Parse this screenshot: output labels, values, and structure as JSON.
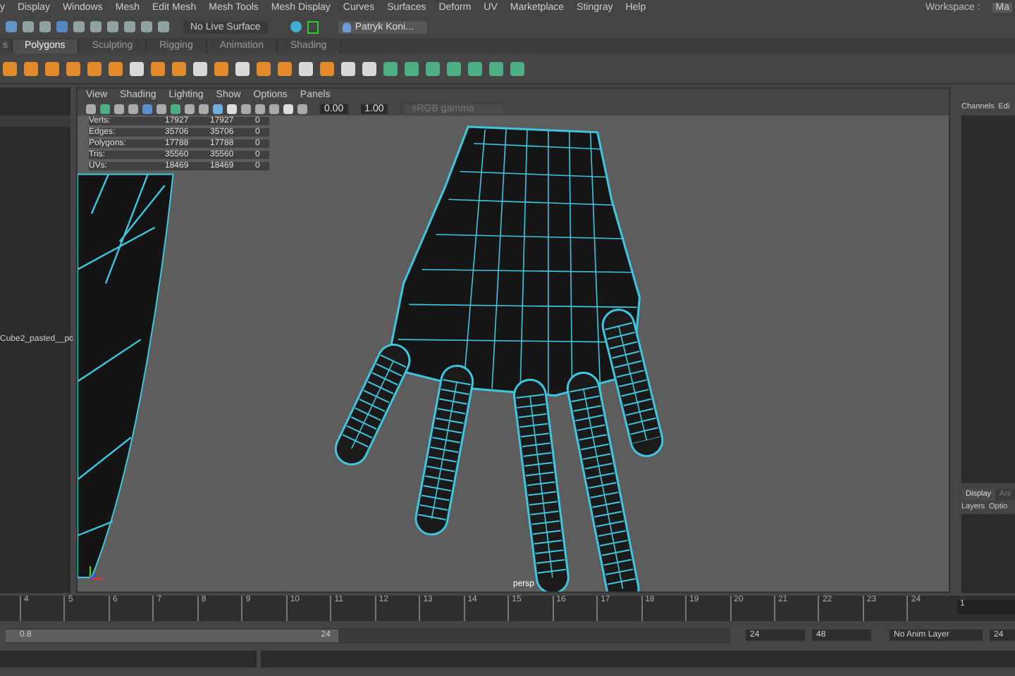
{
  "menu_bar": {
    "items": [
      "y",
      "Display",
      "Windows",
      "Mesh",
      "Edit Mesh",
      "Mesh Tools",
      "Mesh Display",
      "Curves",
      "Surfaces",
      "Deform",
      "UV",
      "Marketplace",
      "Stingray",
      "Help"
    ],
    "workspace_label": "Workspace :",
    "workspace_value": "Ma"
  },
  "status_line": {
    "live_surface": "No Live Surface",
    "user": "Patryk Koni..."
  },
  "shelf_tabs": [
    {
      "label": "s",
      "selected": false
    },
    {
      "label": "Polygons",
      "selected": true
    },
    {
      "label": "Sculpting",
      "selected": false
    },
    {
      "label": "Rigging",
      "selected": false
    },
    {
      "label": "Animation",
      "selected": false
    },
    {
      "label": "Shading",
      "selected": false
    }
  ],
  "outliner": {
    "item": "Cube2_pasted__pc"
  },
  "viewport": {
    "menu": [
      "View",
      "Shading",
      "Lighting",
      "Show",
      "Options",
      "Panels"
    ],
    "exposure": "0.00",
    "gamma": "1.00",
    "color_space": "sRGB gamma",
    "camera": "persp",
    "hud": [
      {
        "label": "Verts:",
        "values": [
          "17927",
          "17927",
          "0"
        ]
      },
      {
        "label": "Edges:",
        "values": [
          "35706",
          "35706",
          "0"
        ]
      },
      {
        "label": "Polygons:",
        "values": [
          "17788",
          "17788",
          "0"
        ]
      },
      {
        "label": "Tris:",
        "values": [
          "35560",
          "35560",
          "0"
        ]
      },
      {
        "label": "UVs:",
        "values": [
          "18469",
          "18469",
          "0"
        ]
      }
    ]
  },
  "channel_box": {
    "tabs": [
      "Channels",
      "Edi"
    ],
    "layer_tabs": [
      {
        "label": "Display",
        "selected": true
      },
      {
        "label": "Ani",
        "selected": false
      }
    ],
    "layer_menu": [
      "Layers",
      "Optio"
    ]
  },
  "timeline": {
    "ticks": [
      "4",
      "5",
      "6",
      "7",
      "8",
      "9",
      "10",
      "11",
      "12",
      "13",
      "14",
      "15",
      "16",
      "17",
      "18",
      "19",
      "20",
      "21",
      "22",
      "23",
      "24"
    ],
    "current_frame": "1"
  },
  "range": {
    "level": 0.46,
    "start": "0.8",
    "end": "24",
    "field_1": "24",
    "field_2": "48",
    "anim_layer": "No Anim Layer",
    "field_3": "24"
  }
}
